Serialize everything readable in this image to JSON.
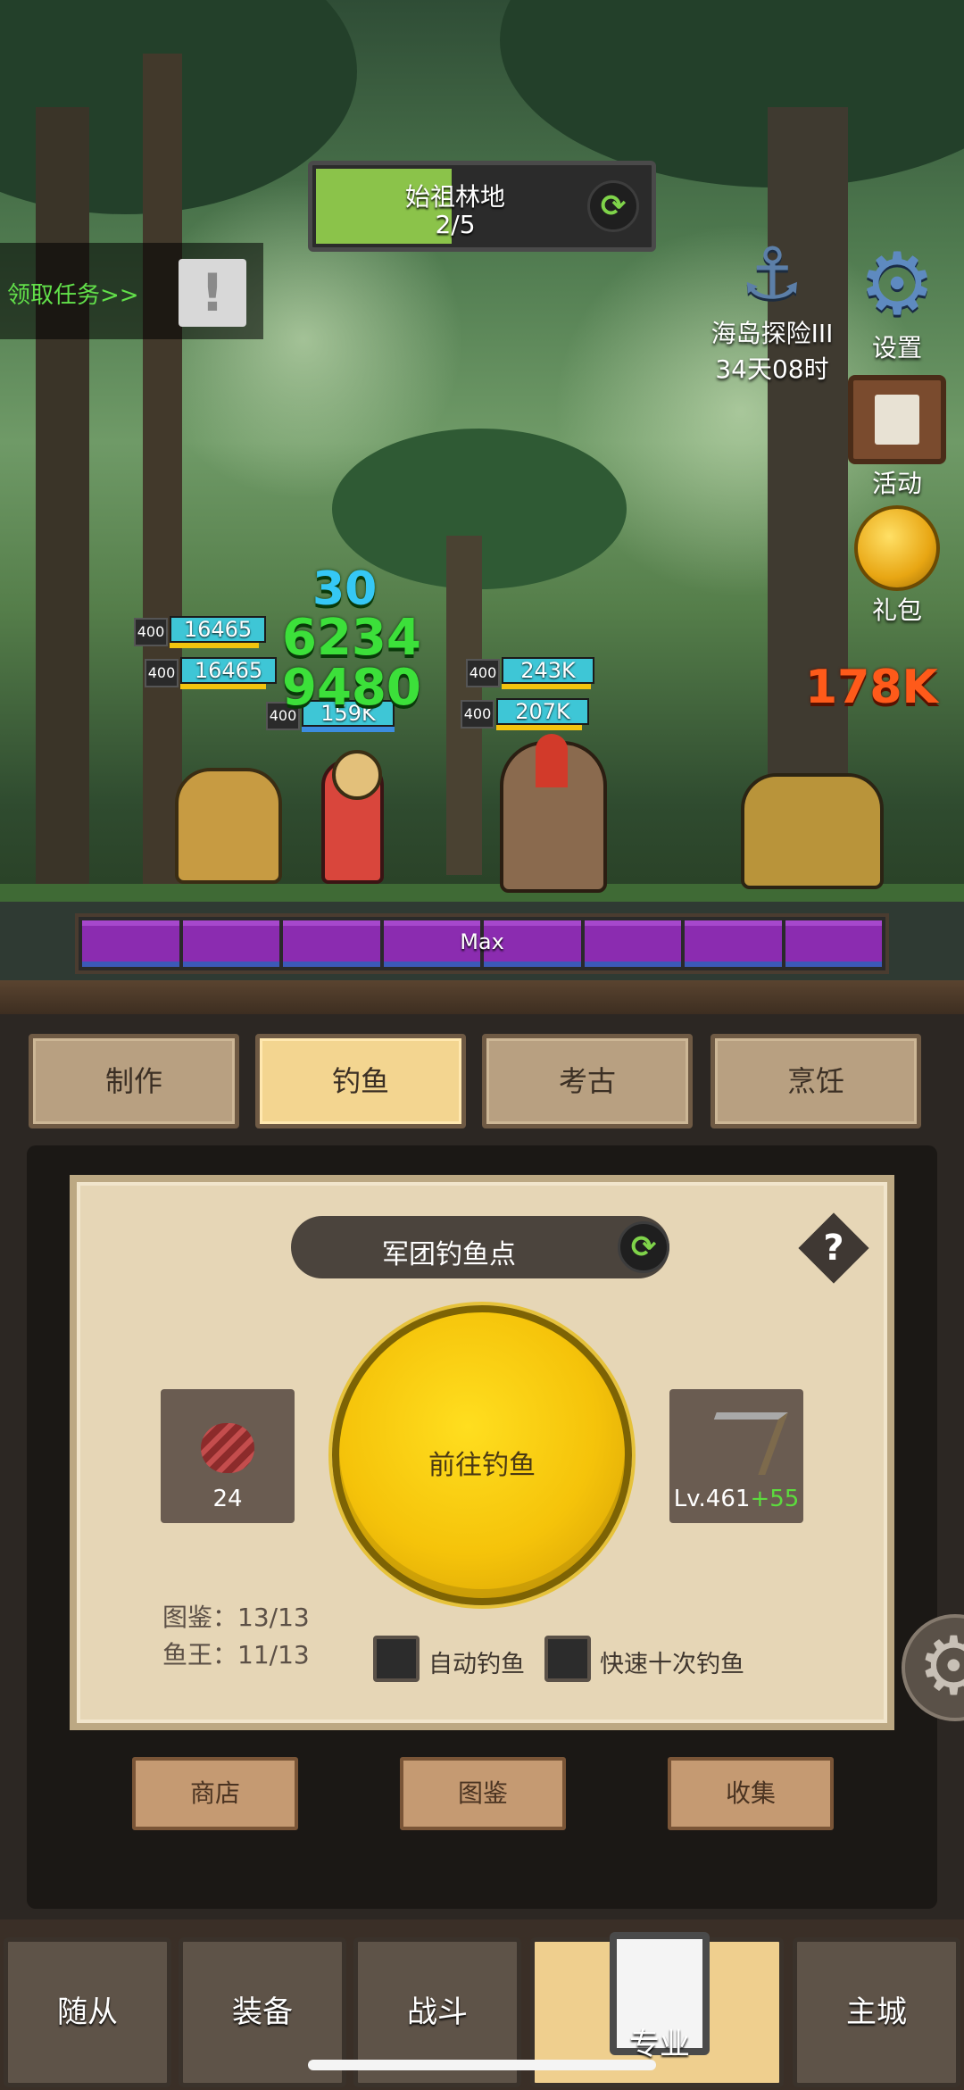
{
  "stage": {
    "name": "始祖林地",
    "progress_text": "2/5",
    "progress": 0.4
  },
  "quest": {
    "label": "领取任务>>",
    "icon": "exclamation-icon"
  },
  "side_menu": [
    {
      "id": "event",
      "label": "海岛探险III",
      "sub": "34天08时",
      "icon": "anchor-icon"
    },
    {
      "id": "settings",
      "label": "设置",
      "icon": "gear-icon"
    },
    {
      "id": "activity",
      "label": "活动",
      "icon": "board-icon"
    },
    {
      "id": "gift",
      "label": "礼包",
      "icon": "gift-icon"
    }
  ],
  "battle": {
    "allies": [
      {
        "level": "400",
        "hp": "16465"
      },
      {
        "level": "400",
        "hp": "16465"
      },
      {
        "level": "400",
        "hp": "159K"
      }
    ],
    "enemies": [
      {
        "level": "400",
        "hp": "243K"
      },
      {
        "level": "400",
        "hp": "207K"
      }
    ],
    "damage_numbers": [
      "30",
      "6234",
      "9480"
    ],
    "enemy_damage": "178K",
    "boss_bar_label": "Max",
    "colors": {
      "damage_blue": "#35c8f5",
      "damage_green": "#3ce03a",
      "damage_orange": "#ff5a1a",
      "boss_bar": "#8b2cb0"
    }
  },
  "tabs": [
    {
      "label": "制作",
      "active": false
    },
    {
      "label": "钓鱼",
      "active": true
    },
    {
      "label": "考古",
      "active": false
    },
    {
      "label": "烹饪",
      "active": false
    }
  ],
  "fishing": {
    "spot_name": "军团钓鱼点",
    "help": "?",
    "bait": {
      "count": "24",
      "icon": "bait-icon"
    },
    "rod": {
      "level": "Lv.461",
      "bonus": "+55",
      "icon": "fishing-rod-icon"
    },
    "go_button": "前往钓鱼",
    "stats": [
      "图鉴：13/13",
      "鱼王：11/13"
    ],
    "options": [
      {
        "label": "自动钓鱼",
        "checked": false
      },
      {
        "label": "快速十次钓鱼",
        "checked": false
      }
    ],
    "buttons": [
      "商店",
      "图鉴",
      "收集"
    ]
  },
  "nav": [
    {
      "label": "随从",
      "active": false
    },
    {
      "label": "装备",
      "active": false
    },
    {
      "label": "战斗",
      "active": false
    },
    {
      "label": "专业",
      "active": true
    },
    {
      "label": "主城",
      "active": false
    }
  ]
}
